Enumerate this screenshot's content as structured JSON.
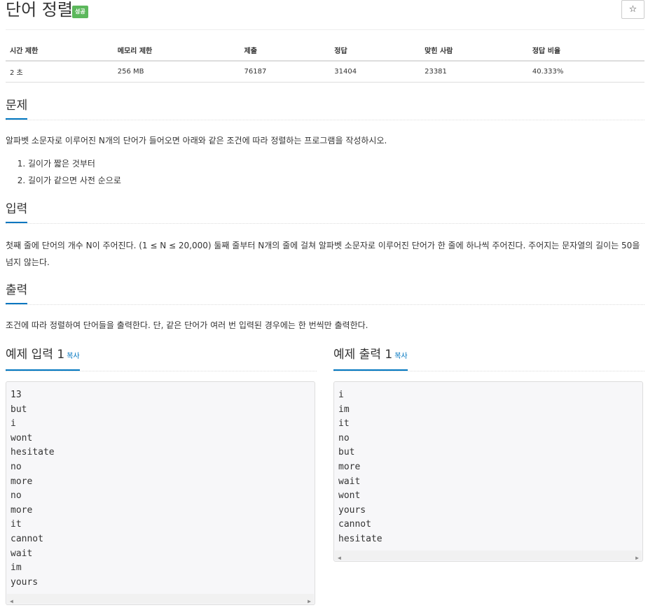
{
  "header": {
    "title": "단어 정렬",
    "badge": "성공",
    "star": "☆"
  },
  "stats": {
    "headers": [
      "시간 제한",
      "메모리 제한",
      "제출",
      "정답",
      "맞힌 사람",
      "정답 비율"
    ],
    "values": [
      "2 초",
      "256 MB",
      "76187",
      "31404",
      "23381",
      "40.333%"
    ]
  },
  "problem": {
    "heading": "문제",
    "text": "알파벳 소문자로 이루어진 N개의 단어가 들어오면 아래와 같은 조건에 따라 정렬하는 프로그램을 작성하시오.",
    "items": [
      "길이가 짧은 것부터",
      "길이가 같으면 사전 순으로"
    ]
  },
  "input": {
    "heading": "입력",
    "text": "첫째 줄에 단어의 개수 N이 주어진다. (1 ≤ N ≤ 20,000) 둘째 줄부터 N개의 줄에 걸쳐 알파벳 소문자로 이루어진 단어가 한 줄에 하나씩 주어진다. 주어지는 문자열의 길이는 50을 넘지 않는다."
  },
  "output": {
    "heading": "출력",
    "text": "조건에 따라 정렬하여 단어들을 출력한다. 단, 같은 단어가 여러 번 입력된 경우에는 한 번씩만 출력한다."
  },
  "sample_input": {
    "heading": "예제 입력 1",
    "copy": "복사",
    "lines": [
      "13",
      "but",
      "i",
      "wont",
      "hesitate",
      "no",
      "more",
      "no",
      "more",
      "it",
      "cannot",
      "wait",
      "im",
      "yours"
    ]
  },
  "sample_output": {
    "heading": "예제 출력 1",
    "copy": "복사",
    "lines": [
      "i",
      "im",
      "it",
      "no",
      "but",
      "more",
      "wait",
      "wont",
      "yours",
      "cannot",
      "hesitate"
    ]
  },
  "colors": {
    "accent": "#0076c0",
    "success": "#5cb85c"
  }
}
